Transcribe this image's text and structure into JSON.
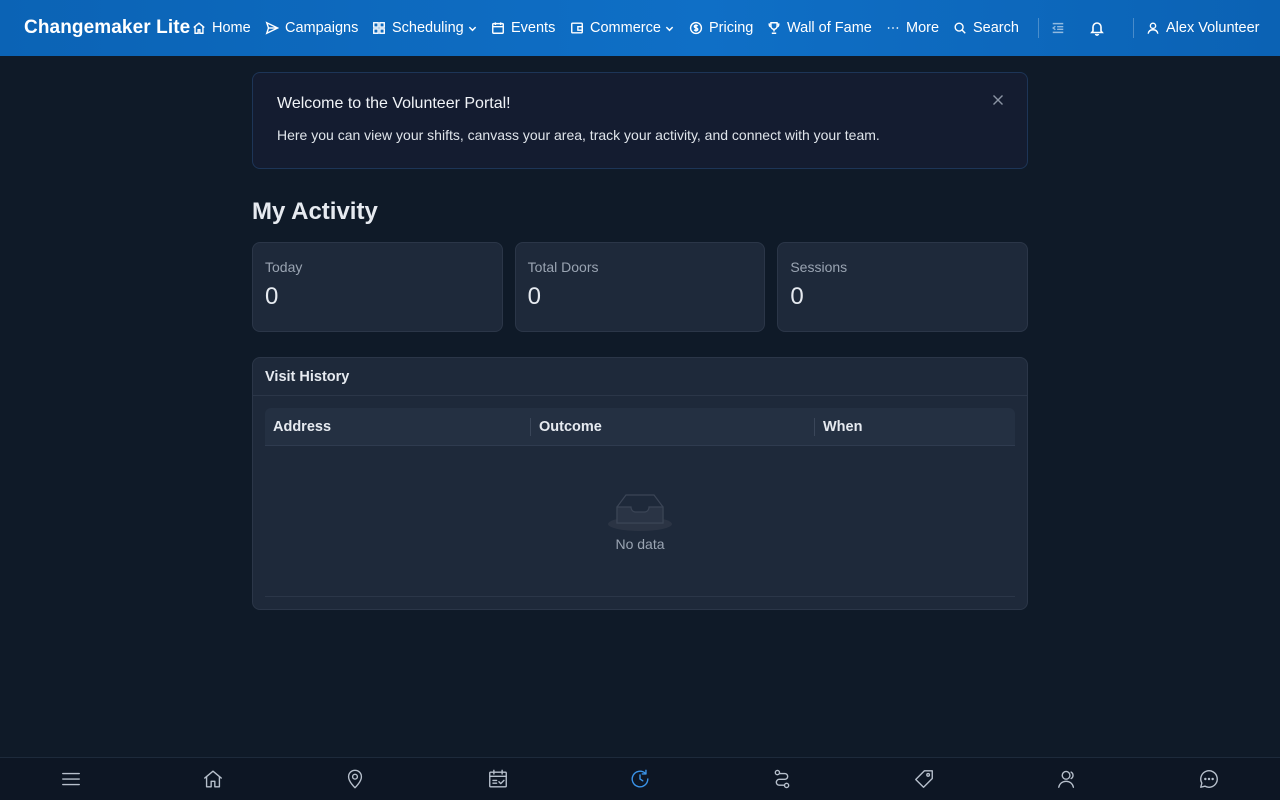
{
  "app": {
    "title": "Changemaker Lite"
  },
  "nav": {
    "items": [
      {
        "label": "Home",
        "icon": "home-icon"
      },
      {
        "label": "Campaigns",
        "icon": "send-icon"
      },
      {
        "label": "Scheduling",
        "icon": "grid-icon",
        "has_dropdown": true
      },
      {
        "label": "Events",
        "icon": "calendar-icon"
      },
      {
        "label": "Commerce",
        "icon": "wallet-icon",
        "has_dropdown": true
      },
      {
        "label": "Pricing",
        "icon": "dollar-circle-icon"
      },
      {
        "label": "Wall of Fame",
        "icon": "trophy-icon"
      },
      {
        "label": "More",
        "icon": "ellipsis-icon"
      }
    ],
    "search_label": "Search",
    "user_name": "Alex Volunteer"
  },
  "alert": {
    "title": "Welcome to the Volunteer Portal!",
    "message": "Here you can view your shifts, canvass your area, track your activity, and connect with your team."
  },
  "page": {
    "title": "My Activity"
  },
  "stats": [
    {
      "label": "Today",
      "value": "0"
    },
    {
      "label": "Total Doors",
      "value": "0"
    },
    {
      "label": "Sessions",
      "value": "0"
    }
  ],
  "history": {
    "title": "Visit History",
    "columns": [
      "Address",
      "Outcome",
      "When"
    ],
    "rows": [],
    "empty_text": "No data"
  },
  "bottom_tabs": [
    {
      "icon": "menu-icon",
      "active": false
    },
    {
      "icon": "home-icon",
      "active": false
    },
    {
      "icon": "map-pin-icon",
      "active": false
    },
    {
      "icon": "calendar-check-icon",
      "active": false
    },
    {
      "icon": "history-clock-icon",
      "active": true
    },
    {
      "icon": "route-icon",
      "active": false
    },
    {
      "icon": "tag-icon",
      "active": false
    },
    {
      "icon": "team-icon",
      "active": false
    },
    {
      "icon": "chat-icon",
      "active": false
    }
  ],
  "colors": {
    "topbar": "#0f6fc6",
    "background": "#0f1a28",
    "card": "#1e293a",
    "active_tab": "#3a93e8"
  }
}
